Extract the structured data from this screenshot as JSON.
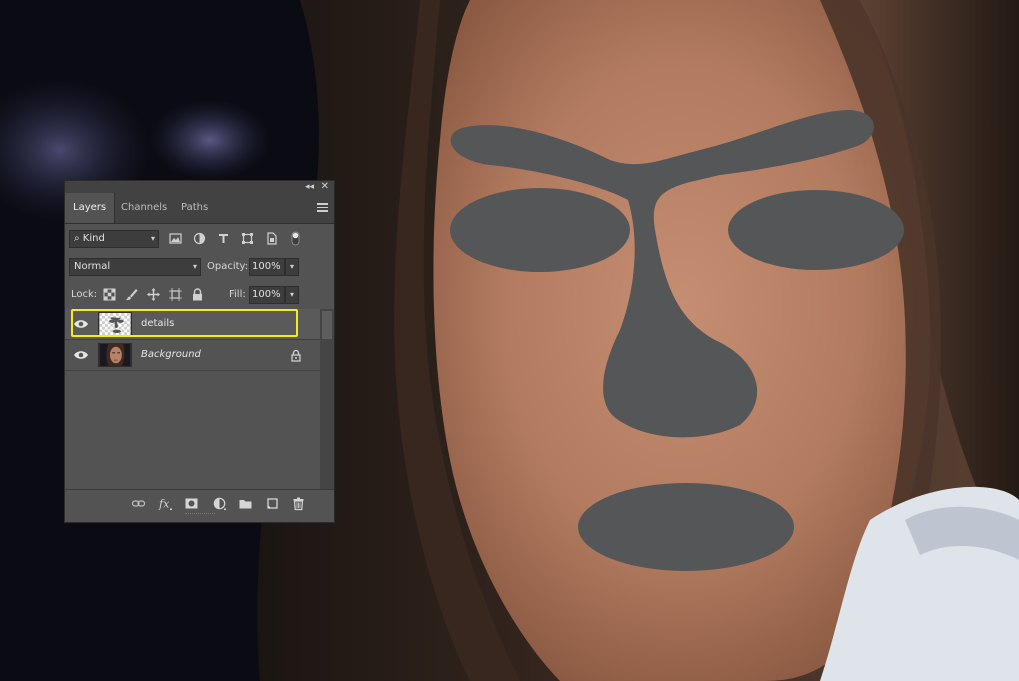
{
  "panel": {
    "tabs": [
      "Layers",
      "Channels",
      "Paths"
    ],
    "filter": {
      "kind_label": "Kind"
    },
    "blend_mode": "Normal",
    "opacity_label": "Opacity:",
    "opacity_value": "100%",
    "lock_label": "Lock:",
    "fill_label": "Fill:",
    "fill_value": "100%",
    "layers": [
      {
        "name": "details",
        "selected": true,
        "visible": true,
        "locked": false
      },
      {
        "name": "Background",
        "selected": false,
        "visible": true,
        "locked": true
      }
    ]
  },
  "colors": {
    "panel_bg": "#535353",
    "panel_dark": "#424242",
    "highlight": "#f2ee1a",
    "mask_gray": "#555657",
    "skin": "#b88268",
    "hair": "#4a3428"
  },
  "icons": {
    "collapse": "double-chevron-left-icon",
    "close": "close-icon",
    "menu": "panel-menu-icon",
    "search": "search-icon",
    "eye": "eye-icon",
    "lock": "lock-icon"
  }
}
